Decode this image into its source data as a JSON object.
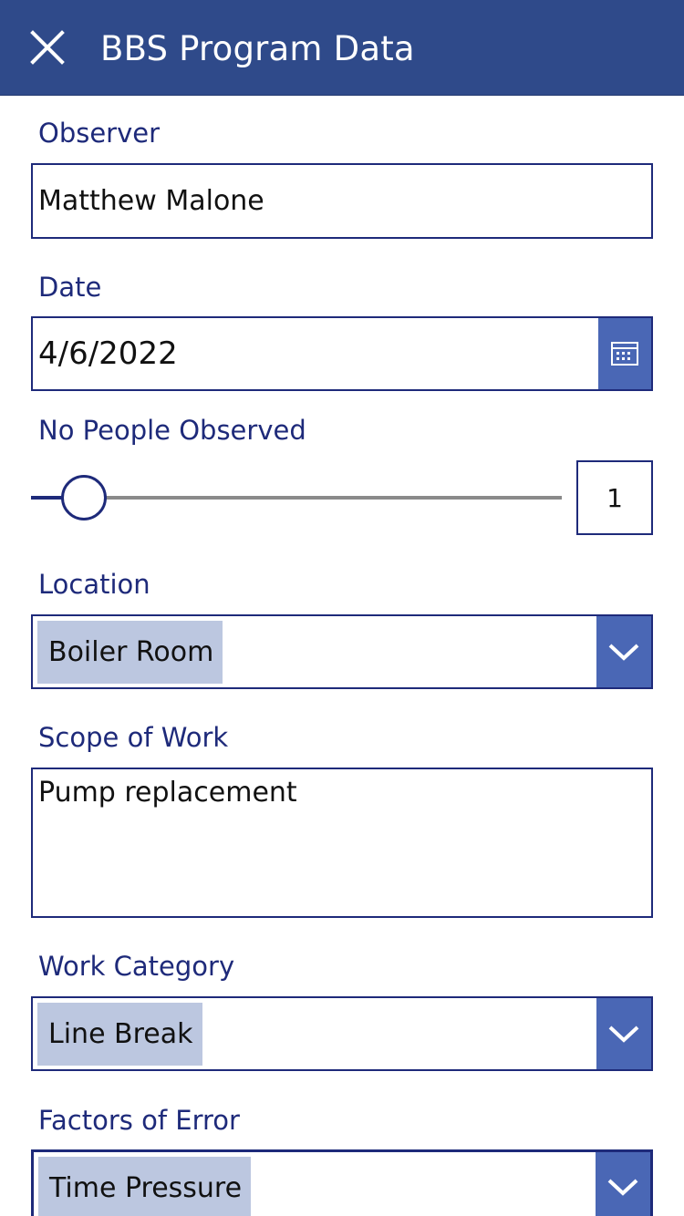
{
  "header": {
    "title": "BBS Program Data",
    "close_icon": "close-icon",
    "background": "#2f4a8a"
  },
  "form": {
    "observer": {
      "label": "Observer",
      "value": "Matthew Malone"
    },
    "date": {
      "label": "Date",
      "value": "4/6/2022",
      "icon": "calendar-icon"
    },
    "people": {
      "label": "No People Observed",
      "value": "1"
    },
    "location": {
      "label": "Location",
      "selected": "Boiler Room",
      "icon": "chevron-down-icon"
    },
    "scope": {
      "label": "Scope of Work",
      "value": "Pump replacement"
    },
    "category": {
      "label": "Work Category",
      "selected": "Line Break",
      "icon": "chevron-down-icon"
    },
    "factors": {
      "label": "Factors of Error",
      "selected": "Time Pressure",
      "icon": "chevron-down-icon"
    }
  },
  "colors": {
    "accent": "#4a67b5",
    "label_text": "#1e2a7a",
    "chip": "#bcc7e0"
  }
}
